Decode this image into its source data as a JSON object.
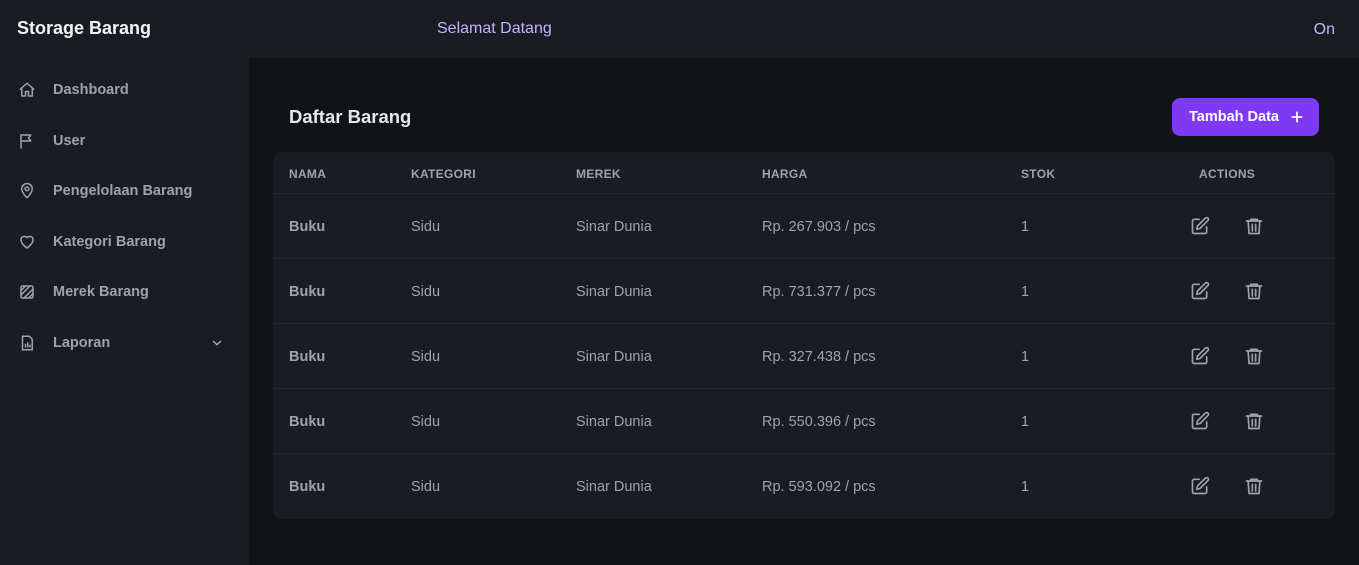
{
  "header": {
    "brand": "Storage Barang",
    "welcome": "Selamat Datang",
    "status": "On"
  },
  "sidebar": {
    "items": [
      {
        "label": "Dashboard",
        "icon": "home-icon"
      },
      {
        "label": "User",
        "icon": "flag-icon"
      },
      {
        "label": "Pengelolaan Barang",
        "icon": "location-pin-icon"
      },
      {
        "label": "Kategori Barang",
        "icon": "heart-icon"
      },
      {
        "label": "Merek Barang",
        "icon": "texture-icon"
      },
      {
        "label": "Laporan",
        "icon": "report-icon",
        "expandable": true
      }
    ]
  },
  "main": {
    "title": "Daftar Barang",
    "add_button": "Tambah Data"
  },
  "table": {
    "columns": [
      "NAMA",
      "KATEGORI",
      "MEREK",
      "HARGA",
      "STOK",
      "ACTIONS"
    ],
    "rows": [
      {
        "nama": "Buku",
        "kategori": "Sidu",
        "merek": "Sinar Dunia",
        "harga": "Rp. 267.903 / pcs",
        "stok": "1"
      },
      {
        "nama": "Buku",
        "kategori": "Sidu",
        "merek": "Sinar Dunia",
        "harga": "Rp. 731.377 / pcs",
        "stok": "1"
      },
      {
        "nama": "Buku",
        "kategori": "Sidu",
        "merek": "Sinar Dunia",
        "harga": "Rp. 327.438 / pcs",
        "stok": "1"
      },
      {
        "nama": "Buku",
        "kategori": "Sidu",
        "merek": "Sinar Dunia",
        "harga": "Rp. 550.396 / pcs",
        "stok": "1"
      },
      {
        "nama": "Buku",
        "kategori": "Sidu",
        "merek": "Sinar Dunia",
        "harga": "Rp. 593.092 / pcs",
        "stok": "1"
      }
    ]
  },
  "colors": {
    "accent": "#7e3af2",
    "header_text": "#c4b5fd",
    "background": "#121317",
    "panel": "#1a1c23"
  }
}
